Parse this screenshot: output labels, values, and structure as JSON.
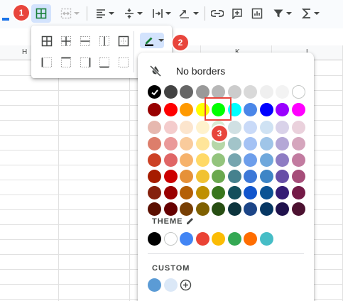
{
  "columns": [
    "H",
    "K",
    "L"
  ],
  "toolbar": {
    "icons": [
      "fill-color-icon",
      "borders-icon",
      "merge-cells-icon",
      "align-horizontal-icon",
      "align-vertical-icon",
      "text-wrap-icon",
      "text-rotation-icon",
      "link-icon",
      "comment-icon",
      "chart-icon",
      "filter-icon",
      "functions-icon"
    ]
  },
  "palette": {
    "no_borders_label": "No borders",
    "theme_label": "THEME",
    "custom_label": "CUSTOM",
    "selected_color": "#000000",
    "highlighted_color": "#00ff00",
    "standard_rows": [
      [
        "#000000",
        "#434343",
        "#666666",
        "#999999",
        "#b7b7b7",
        "#cccccc",
        "#d9d9d9",
        "#efefef",
        "#f3f3f3",
        "#ffffff"
      ],
      [
        "#980000",
        "#ff0000",
        "#ff9900",
        "#ffff00",
        "#00ff00",
        "#00ffff",
        "#4a86e8",
        "#0000ff",
        "#9900ff",
        "#ff00ff"
      ],
      [
        "#e6b8af",
        "#f4cccc",
        "#fce5cd",
        "#fff2cc",
        "#d9ead3",
        "#d0e0e3",
        "#c9daf8",
        "#cfe2f3",
        "#d9d2e9",
        "#ead1dc"
      ],
      [
        "#dd7e6b",
        "#ea9999",
        "#f9cb9c",
        "#ffe599",
        "#b6d7a8",
        "#a2c4c9",
        "#a4c2f4",
        "#9fc5e8",
        "#b4a7d6",
        "#d5a6bd"
      ],
      [
        "#cc4125",
        "#e06666",
        "#f6b26b",
        "#ffd966",
        "#93c47d",
        "#76a5af",
        "#6d9eeb",
        "#6fa8dc",
        "#8e7cc3",
        "#c27ba0"
      ],
      [
        "#a61c00",
        "#cc0000",
        "#e69138",
        "#f1c232",
        "#6aa84f",
        "#45818e",
        "#3c78d8",
        "#3d85c6",
        "#674ea7",
        "#a64d79"
      ],
      [
        "#85200c",
        "#990000",
        "#b45f06",
        "#bf9000",
        "#38761d",
        "#134f5c",
        "#1155cc",
        "#0b5394",
        "#351c75",
        "#741b47"
      ],
      [
        "#5b0f00",
        "#660000",
        "#783f04",
        "#7f6000",
        "#274e13",
        "#0c343d",
        "#1c4587",
        "#073763",
        "#20124d",
        "#4c1130"
      ]
    ],
    "theme_colors": [
      "#000000",
      "#ffffff",
      "#4285f4",
      "#ea4335",
      "#fbbc04",
      "#34a853",
      "#ff6d01",
      "#46bdc6"
    ],
    "custom_colors": [
      "#5b9bd5",
      "#dbe8f7"
    ]
  },
  "annotations": [
    "1",
    "2",
    "3"
  ],
  "accent": "#e8453c"
}
